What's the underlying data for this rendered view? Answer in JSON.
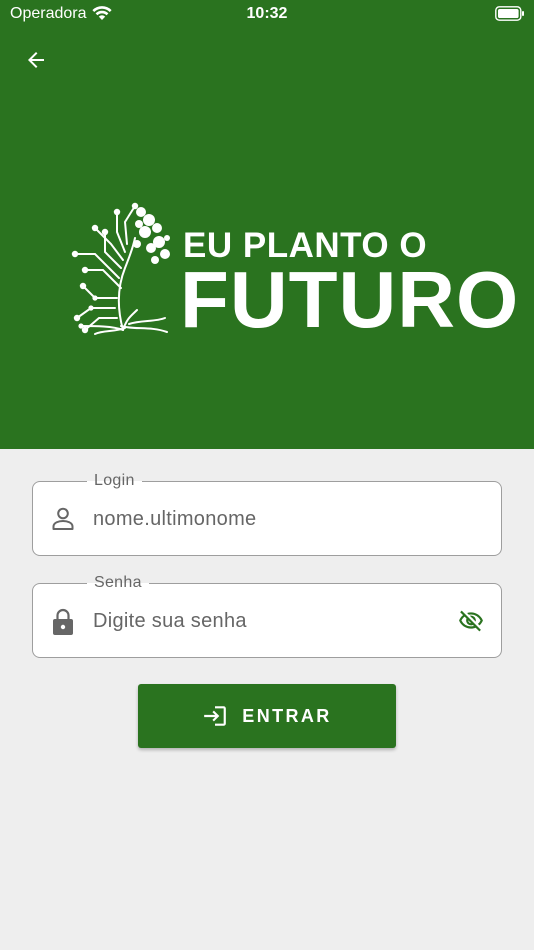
{
  "status_bar": {
    "carrier": "Operadora",
    "time": "10:32"
  },
  "header": {
    "back_icon": "arrow-left-icon",
    "logo": {
      "line1": "EU PLANTO O",
      "line2": "FUTURO",
      "emblem": "tree-circuit-icon"
    }
  },
  "form": {
    "login": {
      "label": "Login",
      "placeholder": "nome.ultimonome",
      "icon": "person-icon"
    },
    "password": {
      "label": "Senha",
      "placeholder": "Digite sua senha",
      "icon": "lock-icon",
      "toggle_icon": "eye-off-icon"
    },
    "submit": {
      "label": "ENTRAR",
      "icon": "login-icon"
    }
  },
  "colors": {
    "primary": "#2a731f",
    "background": "#eeeeee"
  }
}
